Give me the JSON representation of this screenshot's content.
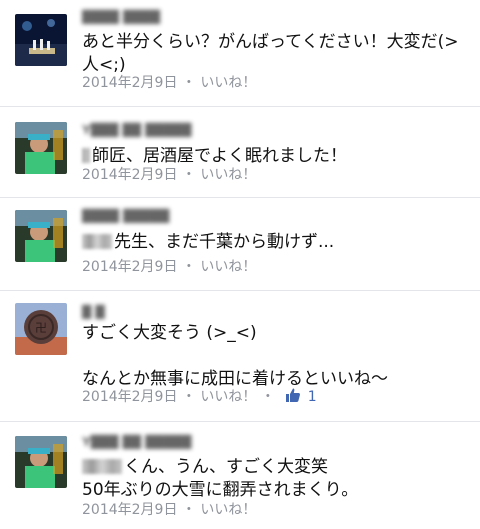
{
  "comments": [
    {
      "name": "████ ████",
      "line1": "あと半分くらい？がんばってください！大変だ(>",
      "line2": "人<;)",
      "date": "2014年2月9日",
      "like": "いいね！"
    },
    {
      "name": "Y███ ██ █████",
      "line1": "師匠、居酒屋でよく眠れました！",
      "date": "2014年2月9日",
      "like": "いいね！"
    },
    {
      "name": "████ █████",
      "line1": "先生、まだ千葉から動けず...",
      "date": "2014年2月9日",
      "like": "いいね！"
    },
    {
      "name": "█ █",
      "line1": "すごく大変そう (>_<)",
      "line2": "なんとか無事に成田に着けるといいね〜",
      "date": "2014年2月9日",
      "like": "いいね！",
      "like_count": "1"
    },
    {
      "name": "Y███ ██ █████",
      "line1": "くん、うん、すごく大変笑",
      "line2": "50年ぶりの大雪に翻弄されまくり。",
      "date": "2014年2月9日",
      "like": "いいね！"
    }
  ],
  "separator": "・",
  "icons": {
    "like": "thumbs-up-icon"
  },
  "colors": {
    "meta": "#90949c",
    "like_blue": "#4267b2",
    "divider": "#e3e5ea"
  }
}
